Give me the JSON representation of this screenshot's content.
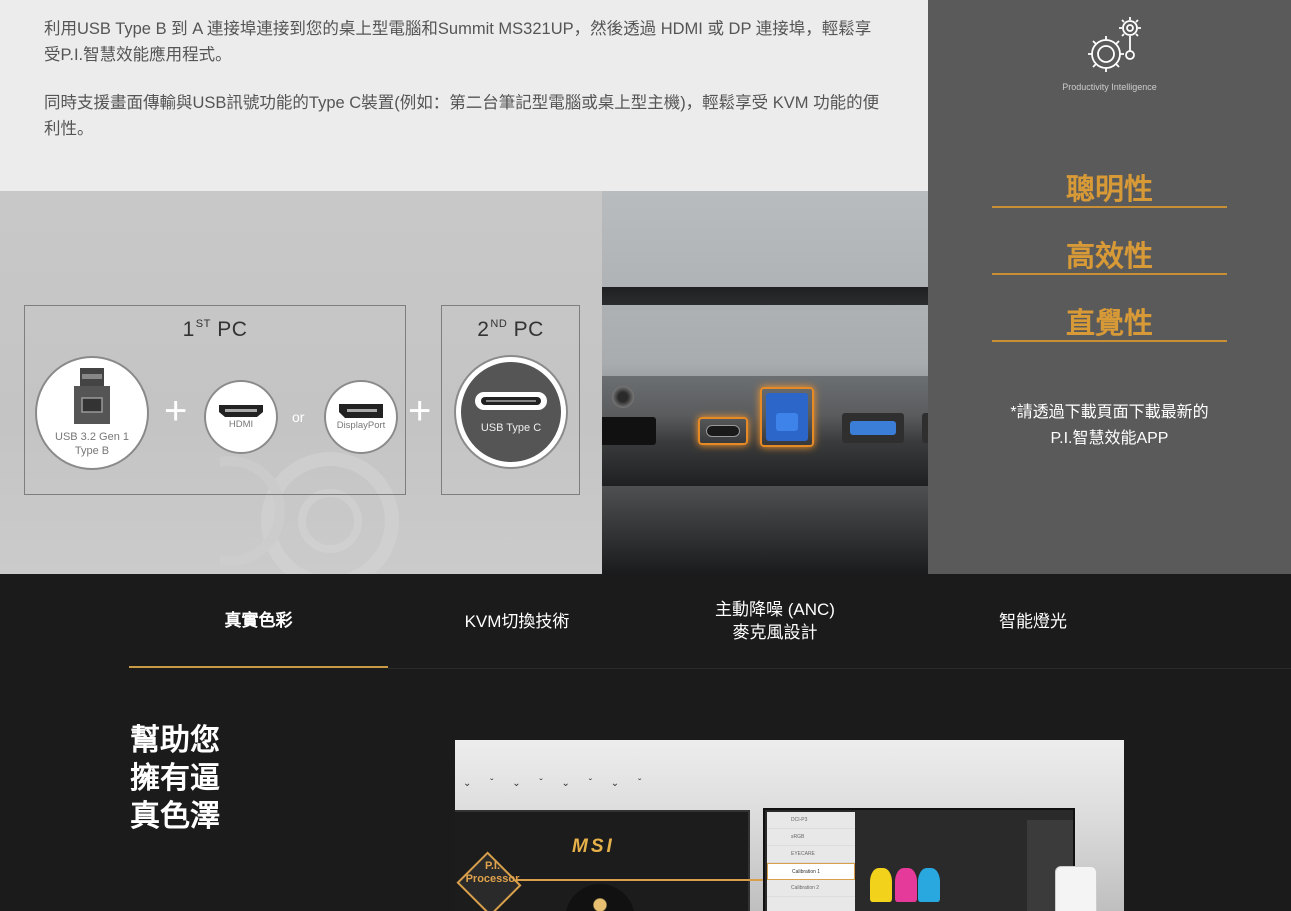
{
  "intro": {
    "para1": "利用USB Type B 到 A 連接埠連接到您的桌上型電腦和Summit MS321UP，然後透過 HDMI 或 DP 連接埠，輕鬆享受P.I.智慧效能應用程式。",
    "para2": "同時支援畫面傳輸與USB訊號功能的Type C裝置(例如：第二台筆記型電腦或桌上型主機)，輕鬆享受 KVM 功能的便利性。"
  },
  "diagram": {
    "pc1_title": "1",
    "pc1_sup": "ST",
    "pc1_suffix": " PC",
    "pc2_title": "2",
    "pc2_sup": "ND",
    "pc2_suffix": " PC",
    "usb_b_label_1": "USB 3.2 Gen 1",
    "usb_b_label_2": "Type B",
    "hdmi_label": "HDMI",
    "dp_label": "DisplayPort",
    "usbc_label": "USB Type C",
    "plus": "+",
    "or": "or"
  },
  "sidebar": {
    "logo_caption": "Productivity Intelligence",
    "features": [
      "聰明性",
      "高效性",
      "直覺性"
    ],
    "note_line1": "*請透過下載頁面下載最新的",
    "note_line2": "P.I.智慧效能APP"
  },
  "tabs": [
    {
      "label": "真實色彩",
      "active": true
    },
    {
      "label": "KVM切換技術",
      "active": false
    },
    {
      "label_line1": "主動降噪 (ANC)",
      "label_line2": "麥克風設計",
      "active": false
    },
    {
      "label": "智能燈光",
      "active": false
    }
  ],
  "headline": {
    "line1": "幫助您",
    "line2": "擁有逼",
    "line3": "真色澤"
  },
  "product_image": {
    "brand": "MSI",
    "chip_line1": "P.I.",
    "chip_line2": "Processor",
    "menu_items": [
      "DCI-P3",
      "sRGB",
      "EYECARE",
      "Calibration 1",
      "Calibration 2"
    ],
    "menu_selected": "Calibration 1"
  },
  "colors": {
    "accent_gold": "#d89a36",
    "sidebar_bg": "#5a5a5a",
    "dark_bg": "#1b1b1b",
    "intro_bg": "#ececec"
  }
}
